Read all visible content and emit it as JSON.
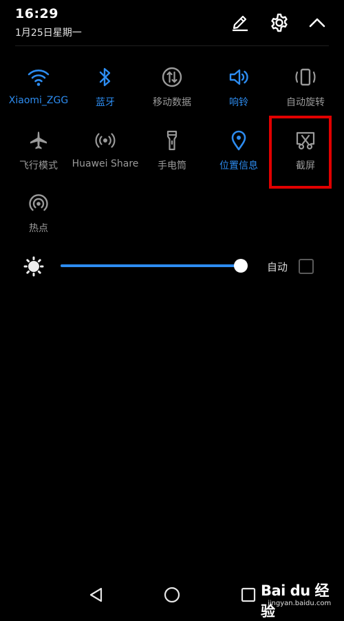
{
  "status": {
    "time": "16:29",
    "date": "1月25日星期一"
  },
  "header_icons": [
    "edit-icon",
    "gear-icon",
    "chevron-up-icon"
  ],
  "tiles": [
    {
      "label": "Xiaomi_ZGG",
      "icon": "wifi-icon",
      "active": true
    },
    {
      "label": "蓝牙",
      "icon": "bluetooth-icon",
      "active": true
    },
    {
      "label": "移动数据",
      "icon": "mobile-data-icon",
      "active": false
    },
    {
      "label": "响铃",
      "icon": "speaker-icon",
      "active": true
    },
    {
      "label": "自动旋转",
      "icon": "auto-rotate-icon",
      "active": false
    },
    {
      "label": "飞行模式",
      "icon": "airplane-icon",
      "active": false
    },
    {
      "label": "Huawei Share",
      "icon": "huawei-share-icon",
      "active": false
    },
    {
      "label": "手电筒",
      "icon": "flashlight-icon",
      "active": false
    },
    {
      "label": "位置信息",
      "icon": "location-icon",
      "active": true
    },
    {
      "label": "截屏",
      "icon": "screenshot-icon",
      "active": false
    },
    {
      "label": "热点",
      "icon": "hotspot-icon",
      "active": false
    }
  ],
  "brightness": {
    "level_percent": 100,
    "auto_label": "自动",
    "auto_checked": false
  },
  "colors": {
    "accent": "#2d8cf0",
    "inactive": "#9a9a9a",
    "highlight_box": "#e10000",
    "background": "#000000"
  },
  "watermark": {
    "logo": "Bai du 经验",
    "url": "jingyan.baidu.com"
  }
}
